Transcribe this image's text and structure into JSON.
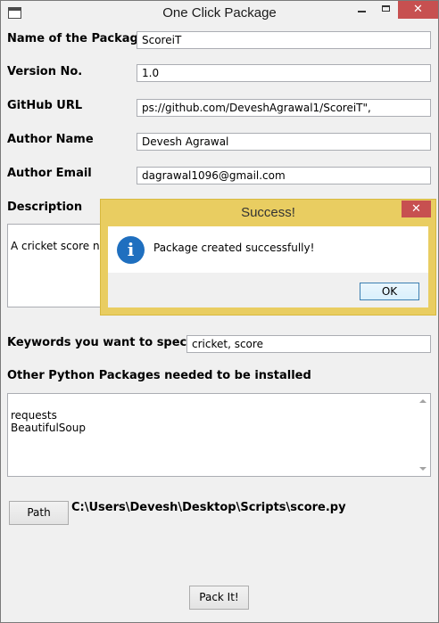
{
  "window": {
    "title": "One Click Package",
    "close_glyph": "✕"
  },
  "form": {
    "package_name": {
      "label": "Name of the Package",
      "value": "ScoreiT"
    },
    "version": {
      "label": "Version No.",
      "value": "1.0"
    },
    "github": {
      "label": "GitHub URL",
      "value": "ps://github.com/DeveshAgrawal1/ScoreiT\","
    },
    "author_name": {
      "label": "Author Name",
      "value": "Devesh Agrawal"
    },
    "author_email": {
      "label": "Author Email",
      "value": "dagrawal1096@gmail.com"
    },
    "description": {
      "label": "Description",
      "value": "A cricket score noti"
    },
    "keywords": {
      "label": "Keywords you want to specify",
      "value": "cricket, score"
    },
    "packages": {
      "label": "Other Python Packages needed to be installed",
      "value": "requests\nBeautifulSoup"
    },
    "path": {
      "button_label": "Path",
      "value": "C:\\Users\\Devesh\\Desktop\\Scripts\\score.py"
    },
    "pack_button_label": "Pack It!"
  },
  "dialog": {
    "title": "Success!",
    "close_glyph": "✕",
    "icon": "info-icon",
    "icon_glyph": "i",
    "message": "Package created successfully!",
    "ok_label": "OK"
  }
}
